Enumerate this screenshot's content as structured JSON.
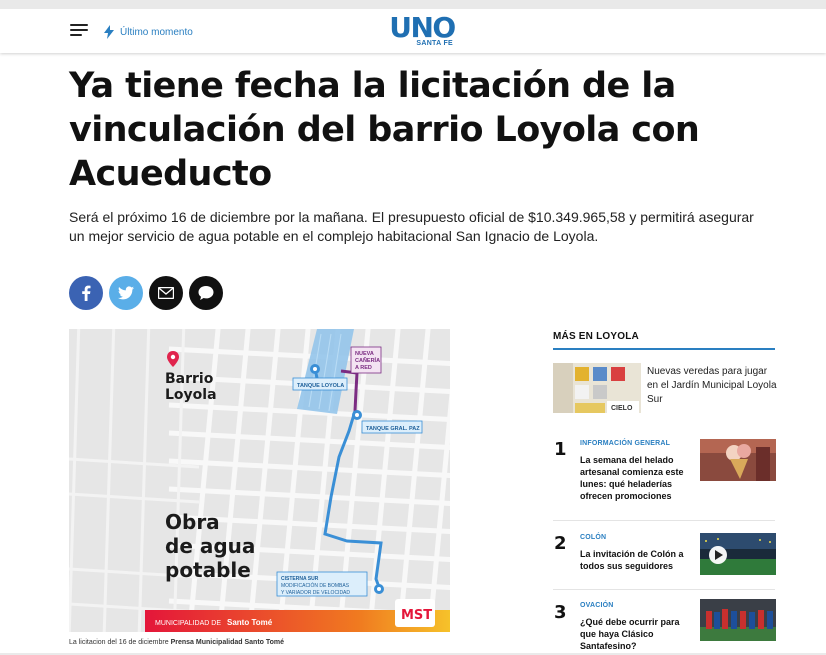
{
  "header": {
    "breaking_label": "Último momento",
    "logo_text": "UNO",
    "logo_sub": "SANTA FE",
    "brand_color": "#1f6fb2",
    "accent_color": "#2a7fc1"
  },
  "article": {
    "title": "Ya tiene fecha la licitación de la vinculación del barrio Loyola con Acueducto",
    "summary": "Será el próximo 16 de diciembre por la mañana. El presupuesto oficial de $10.349.965,58 y permitirá asegurar un mejor servicio de agua potable en el complejo habitacional San Ignacio de Loyola.",
    "share": [
      {
        "name": "facebook",
        "glyph": "f",
        "color": "#3b63b3"
      },
      {
        "name": "twitter",
        "color": "#5aaee8"
      },
      {
        "name": "email",
        "color": "#111111"
      },
      {
        "name": "whatsapp",
        "color": "#111111"
      }
    ],
    "image": {
      "place_title_1": "Barrio",
      "place_title_2": "Loyola",
      "headline_1": "Obra",
      "headline_2": "de agua",
      "headline_3": "potable",
      "label_tanque_loyola": "TANQUE LOYOLA",
      "label_nueva_1": "NUEVA",
      "label_nueva_2": "CAÑERÍA",
      "label_nueva_3": "A RED",
      "label_tanque_gral": "TANQUE GRAL. PAZ",
      "label_cisterna_1": "CISTERNA SUR",
      "label_cisterna_2": "MODIFICACIÓN DE BOMBAS",
      "label_cisterna_3": "Y VARIADOR DE VELOCIDAD",
      "footer_prefix": "MUNICIPALIDAD DE",
      "footer_city": "Santo Tomé",
      "footer_logo": "MST"
    },
    "caption_prefix": "La licitacion del 16 de diciembre",
    "caption_credit": "Prensa Municipalidad Santo Tomé"
  },
  "aside": {
    "title": "MÁS EN LOYOLA",
    "featured": {
      "text": "Nuevas veredas para jugar en el Jardín Municipal Loyola Sur",
      "img_label": "CIELO"
    },
    "items": [
      {
        "num": "1",
        "kicker": "INFORMACIÓN GENERAL",
        "text": "La semana del helado artesanal comienza este lunes: qué heladerías ofrecen promociones"
      },
      {
        "num": "2",
        "kicker": "COLÓN",
        "text": "La invitación de Colón a todos sus seguidores"
      },
      {
        "num": "3",
        "kicker": "OVACIÓN",
        "text": "¿Qué debe ocurrir para que haya Clásico Santafesino?"
      }
    ]
  }
}
